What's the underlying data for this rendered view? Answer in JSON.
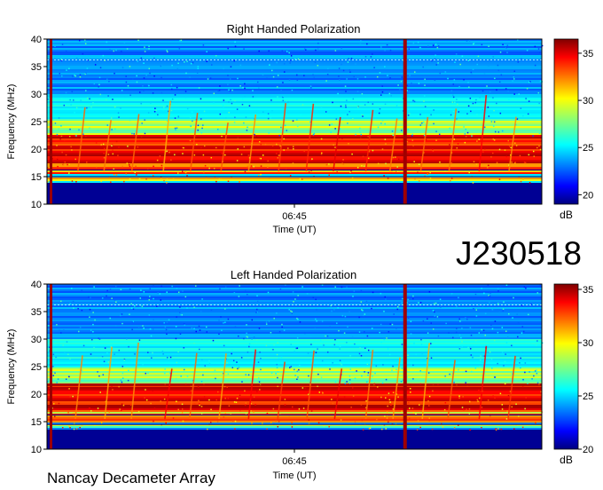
{
  "observation_id": "J230518",
  "instrument": "Nancay Decameter Array",
  "colors": {
    "background_blue": "#00007f",
    "colormap": "jet"
  },
  "chart_data": [
    {
      "type": "heatmap",
      "title": "Right Handed Polarization",
      "xlabel": "Time (UT)",
      "ylabel": "Frequency (MHz)",
      "x_tick_labels": [
        "06:45"
      ],
      "ylim": [
        10,
        40
      ],
      "y_ticks": [
        10,
        15,
        20,
        25,
        30,
        35,
        40
      ],
      "colorbar": {
        "label": "dB",
        "range": [
          19,
          36.5
        ],
        "ticks": [
          20,
          25,
          30,
          35
        ]
      },
      "features": {
        "low_freq_cutoff_mhz": 14,
        "band_center_mhz": 19,
        "band_top_mhz": 22.5,
        "drifting_bursts": 16,
        "vertical_spike_near_start": true,
        "vertical_spike_position": 0.72
      }
    },
    {
      "type": "heatmap",
      "title": "Left Handed Polarization",
      "xlabel": "Time (UT)",
      "ylabel": "Frequency (MHz)",
      "x_tick_labels": [
        "06:45"
      ],
      "ylim": [
        10,
        40
      ],
      "y_ticks": [
        10,
        15,
        20,
        25,
        30,
        35,
        40
      ],
      "colorbar": {
        "label": "dB",
        "range": [
          20,
          35.5
        ],
        "ticks": [
          20,
          25,
          30,
          35
        ]
      },
      "features": {
        "low_freq_cutoff_mhz": 13.5,
        "band_center_mhz": 18.5,
        "band_top_mhz": 22,
        "drifting_bursts": 16,
        "vertical_spike_near_start": true,
        "vertical_spike_position": 0.72
      }
    }
  ]
}
